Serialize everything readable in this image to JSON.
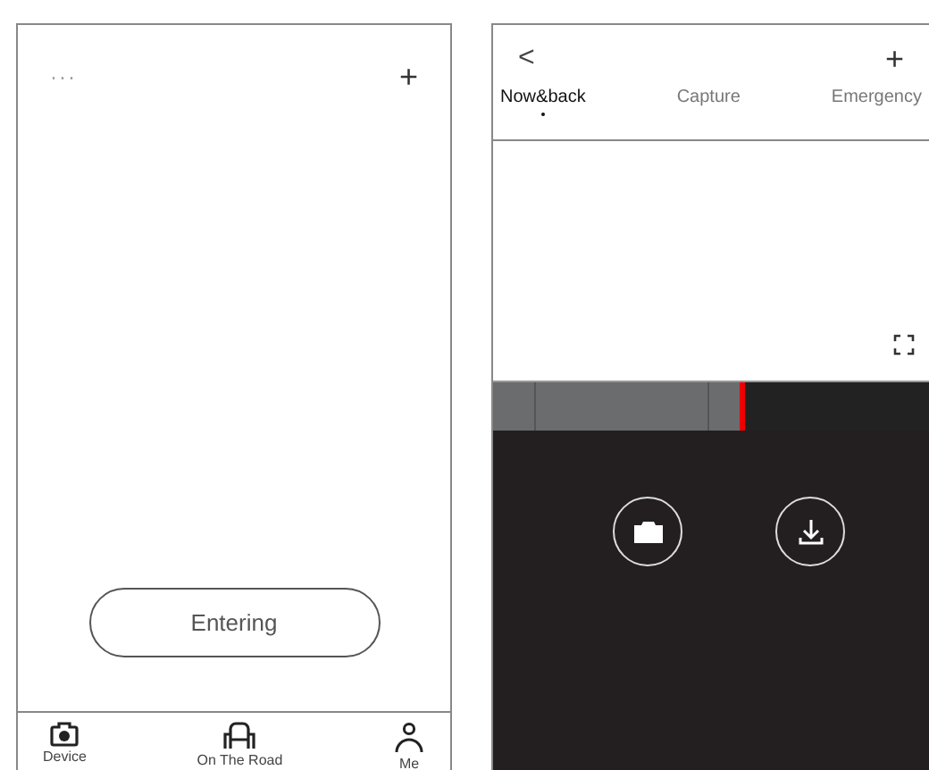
{
  "home_screen": {
    "menu_glyph": "···",
    "add_glyph": "+",
    "enter_button": "Entering",
    "tab_bar": [
      {
        "label": "Device",
        "kind": "camera"
      },
      {
        "label": "On The Road",
        "kind": "seat"
      },
      {
        "label": "Me",
        "kind": "person"
      }
    ]
  },
  "playback_screen": {
    "back_glyph": "<",
    "add_glyph": "+",
    "tabs": [
      {
        "label": "Now&back",
        "selected": true
      },
      {
        "label": "Capture",
        "selected": false
      },
      {
        "label": "Emergency",
        "selected": false
      }
    ],
    "timeline": {
      "level": 0.57
    },
    "actions": [
      {
        "kind": "snapshot"
      },
      {
        "kind": "download"
      }
    ]
  }
}
